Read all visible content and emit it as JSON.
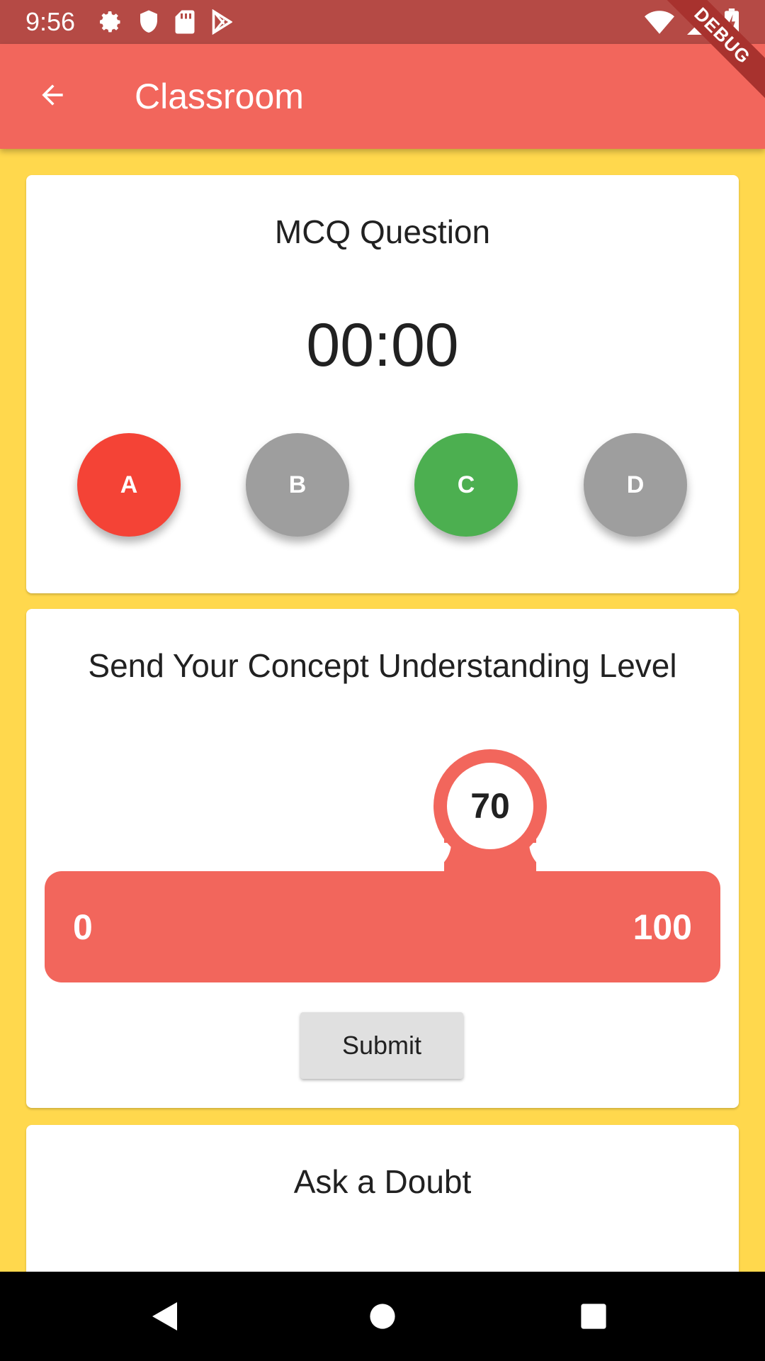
{
  "status_bar": {
    "time": "9:56",
    "left_icons": [
      "settings-icon",
      "shield-icon",
      "sd-card-icon",
      "play-store-icon"
    ],
    "right_icons": [
      "wifi-icon",
      "signal-icon",
      "battery-charging-icon"
    ]
  },
  "debug_banner": "DEBUG",
  "app_bar": {
    "title": "Classroom",
    "back_icon": "arrow-back-icon",
    "background": "#F2665C"
  },
  "mcq": {
    "title": "MCQ Question",
    "timer": "00:00",
    "options": [
      {
        "label": "A",
        "state": "wrong",
        "color": "#F44336"
      },
      {
        "label": "B",
        "state": "neutral",
        "color": "#9E9E9E"
      },
      {
        "label": "C",
        "state": "correct",
        "color": "#4CAF50"
      },
      {
        "label": "D",
        "state": "neutral",
        "color": "#9E9E9E"
      }
    ]
  },
  "understanding": {
    "title": "Send Your Concept Understanding Level",
    "slider": {
      "min": "0",
      "max": "100",
      "value": "70"
    },
    "submit_label": "Submit"
  },
  "doubt": {
    "title": "Ask a Doubt"
  },
  "nav_bar": {
    "icons": [
      "back-triangle-icon",
      "home-circle-icon",
      "recents-square-icon"
    ]
  },
  "colors": {
    "page_background": "#FFD84D",
    "accent": "#F2665C",
    "status_bar": "#B54A45"
  }
}
